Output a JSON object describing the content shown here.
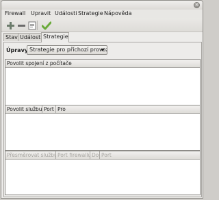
{
  "window": {
    "close_glyph": "×"
  },
  "menubar": {
    "items": [
      "Firewall",
      "Upravit",
      "Události",
      "Strategie",
      "Nápověda"
    ]
  },
  "toolbar": {
    "icons": [
      "add-icon",
      "remove-icon",
      "edit-icon",
      "apply-check-icon"
    ]
  },
  "tabs": [
    {
      "label": "Stav"
    },
    {
      "label": "Události"
    },
    {
      "label": "Strategie",
      "active": true
    }
  ],
  "strategy": {
    "upravy_label": "Úpravy",
    "selected": "Strategie pro příchozí provoz"
  },
  "inbound_list": {
    "headers": [
      "Povolit spojení z počítače"
    ]
  },
  "service_list": {
    "headers": [
      "Povolit službu",
      "Port",
      "Pro"
    ]
  },
  "forward_list": {
    "headers": [
      "Přesměrovat službu",
      "Port firewallu",
      "Do",
      "Port"
    ]
  },
  "colors": {
    "add": "#5a8a4a",
    "check": "#6aaa3a",
    "disabled_text": "#a9a7a3"
  }
}
